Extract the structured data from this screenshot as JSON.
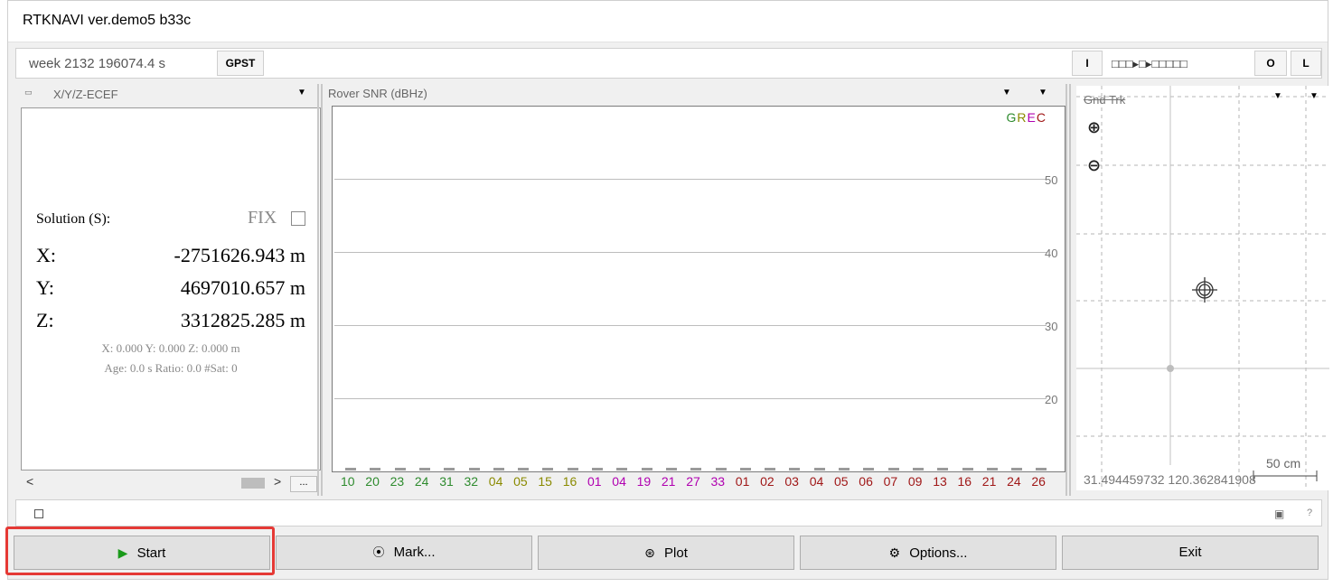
{
  "window": {
    "title": "RTKNAVI ver.demo5 b33c"
  },
  "timebar": {
    "time": "week 2132 196074.4 s",
    "timesys": "GPST",
    "input_btn": "I",
    "streams": "□□□▸□▸□□□□□",
    "output_btn": "O",
    "log_btn": "L"
  },
  "solution_panel": {
    "mode": "X/Y/Z-ECEF",
    "solution_label": "Solution (S):",
    "status": "FIX",
    "x_label": "X:",
    "x_value": "-2751626.943 m",
    "y_label": "Y:",
    "y_value": "4697010.657 m",
    "z_label": "Z:",
    "z_value": "3312825.285 m",
    "std": "X: 0.000 Y: 0.000 Z: 0.000 m",
    "age": "Age: 0.0 s Ratio: 0.0 #Sat: 0",
    "more_btn": "..."
  },
  "snr_panel": {
    "title": "Rover  SNR (dBHz)",
    "legend": [
      "G",
      "R",
      "E",
      "C"
    ],
    "ticks": [
      "50",
      "40",
      "30",
      "20"
    ],
    "satellites": [
      {
        "id": "10",
        "sys": "G"
      },
      {
        "id": "20",
        "sys": "G"
      },
      {
        "id": "23",
        "sys": "G"
      },
      {
        "id": "24",
        "sys": "G"
      },
      {
        "id": "31",
        "sys": "G"
      },
      {
        "id": "32",
        "sys": "G"
      },
      {
        "id": "04",
        "sys": "R"
      },
      {
        "id": "05",
        "sys": "R"
      },
      {
        "id": "15",
        "sys": "R"
      },
      {
        "id": "16",
        "sys": "R"
      },
      {
        "id": "01",
        "sys": "E"
      },
      {
        "id": "04",
        "sys": "E"
      },
      {
        "id": "19",
        "sys": "E"
      },
      {
        "id": "21",
        "sys": "E"
      },
      {
        "id": "27",
        "sys": "E"
      },
      {
        "id": "33",
        "sys": "E"
      },
      {
        "id": "01",
        "sys": "C"
      },
      {
        "id": "02",
        "sys": "C"
      },
      {
        "id": "03",
        "sys": "C"
      },
      {
        "id": "04",
        "sys": "C"
      },
      {
        "id": "05",
        "sys": "C"
      },
      {
        "id": "06",
        "sys": "C"
      },
      {
        "id": "07",
        "sys": "C"
      },
      {
        "id": "09",
        "sys": "C"
      },
      {
        "id": "13",
        "sys": "C"
      },
      {
        "id": "16",
        "sys": "C"
      },
      {
        "id": "21",
        "sys": "C"
      },
      {
        "id": "24",
        "sys": "C"
      },
      {
        "id": "26",
        "sys": "C"
      }
    ]
  },
  "track_panel": {
    "title": "Gnd Trk",
    "coords": "31.494459732 120.362841908",
    "scale": "50 cm"
  },
  "statusbar": {
    "help": "?"
  },
  "buttons": {
    "start": "Start",
    "mark": "Mark...",
    "plot": "Plot",
    "options": "Options...",
    "exit": "Exit"
  },
  "colors": {
    "G": "#2e8b2e",
    "R": "#8a8a00",
    "E": "#b000b0",
    "C": "#a01818",
    "highlight": "#e53935",
    "start_icon": "#1a9a1a"
  }
}
